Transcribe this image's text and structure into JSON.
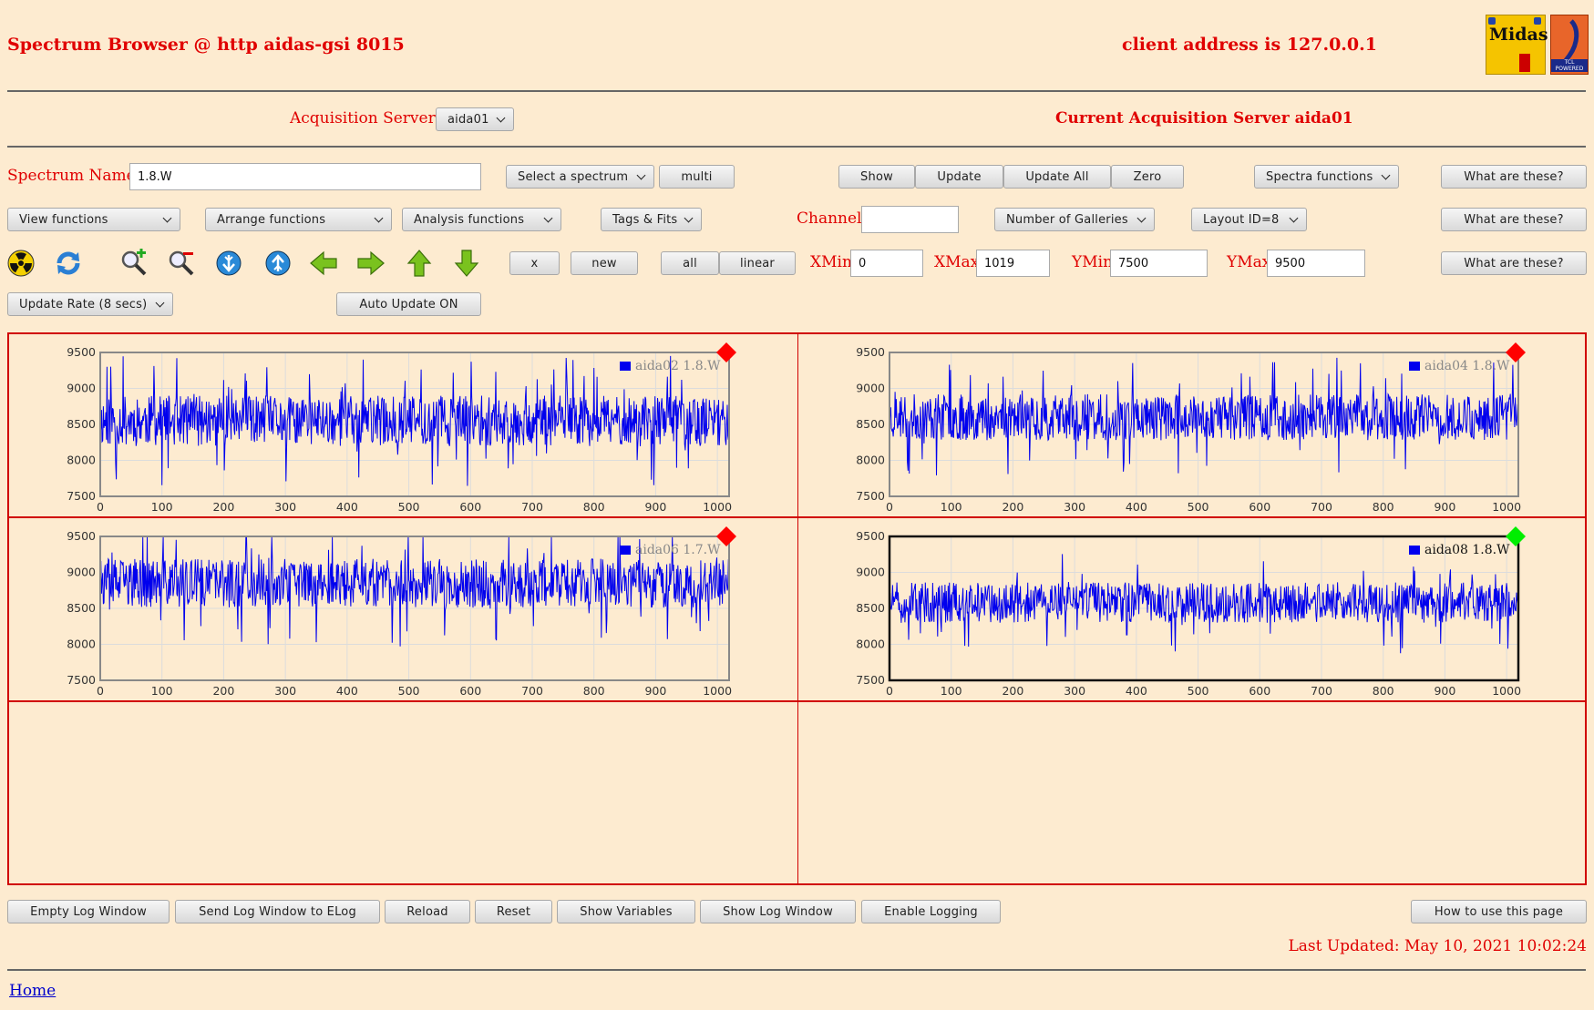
{
  "header": {
    "title": "Spectrum Browser @ http aidas-gsi 8015",
    "client_address": "client address is 127.0.0.1",
    "logo_midas_text": "Midas",
    "logo_tcl_text": "TCL POWERED"
  },
  "servers": {
    "label": "Acquisition Servers",
    "selected": "aida01",
    "current": "Current Acquisition Server aida01"
  },
  "row1": {
    "spectrum_name_label": "Spectrum Name:",
    "spectrum_name_value": "1.8.W",
    "select_spectrum": "Select a spectrum",
    "multi": "multi",
    "show": "Show",
    "update": "Update",
    "update_all": "Update All",
    "zero": "Zero",
    "spectra_functions": "Spectra functions",
    "what1": "What are these?"
  },
  "row2": {
    "view_functions": "View functions",
    "arrange_functions": "Arrange functions",
    "analysis_functions": "Analysis functions",
    "tags_fits": "Tags & Fits",
    "channel_label": "Channel:",
    "channel_value": "",
    "galleries": "Number of Galleries",
    "layout": "Layout ID=8",
    "what2": "What are these?"
  },
  "row3": {
    "x": "x",
    "new": "new",
    "all": "all",
    "linear": "linear",
    "xmin_label": "XMin",
    "xmin": "0",
    "xmax_label": "XMax",
    "xmax": "1019",
    "ymin_label": "YMin",
    "ymin": "7500",
    "ymax_label": "YMax",
    "ymax": "9500",
    "what3": "What are these?"
  },
  "row4": {
    "update_rate": "Update Rate (8 secs)",
    "auto_update": "Auto Update ON"
  },
  "icons": [
    "radiation-icon",
    "refresh-icon",
    "zoom-in-icon",
    "zoom-out-icon",
    "arrow-down-blue-icon",
    "arrow-up-blue-icon",
    "arrow-left-icon",
    "arrow-right-icon",
    "arrow-up-icon",
    "arrow-down-icon"
  ],
  "colors": {
    "background": "#fdebd0",
    "accent": "#e00000",
    "series": "#0000ee",
    "marker_inactive": "#ff0000",
    "marker_active": "#00ee00"
  },
  "chart_data": [
    {
      "type": "line",
      "series": [
        {
          "name": "aida02 1.8.W",
          "seed": 11,
          "base": 8550,
          "amp": 350
        }
      ],
      "xlim": [
        0,
        1019
      ],
      "ylim": [
        7500,
        9500
      ],
      "x_ticks": [
        "0",
        "100",
        "200",
        "300",
        "400",
        "500",
        "600",
        "700",
        "800",
        "900",
        "1000"
      ],
      "y_ticks": [
        "9500",
        "9000",
        "8500",
        "8000",
        "7500"
      ],
      "legend": "top-right",
      "grid": true,
      "active": false
    },
    {
      "type": "line",
      "series": [
        {
          "name": "aida04 1.8.W",
          "seed": 23,
          "base": 8600,
          "amp": 320
        }
      ],
      "xlim": [
        0,
        1019
      ],
      "ylim": [
        7500,
        9500
      ],
      "x_ticks": [
        "0",
        "100",
        "200",
        "300",
        "400",
        "500",
        "600",
        "700",
        "800",
        "900",
        "1000"
      ],
      "y_ticks": [
        "9500",
        "9000",
        "8500",
        "8000",
        "7500"
      ],
      "legend": "top-right",
      "grid": true,
      "active": false
    },
    {
      "type": "line",
      "series": [
        {
          "name": "aida06 1.7.W",
          "seed": 37,
          "base": 8850,
          "amp": 340
        }
      ],
      "xlim": [
        0,
        1019
      ],
      "ylim": [
        7500,
        9500
      ],
      "x_ticks": [
        "0",
        "100",
        "200",
        "300",
        "400",
        "500",
        "600",
        "700",
        "800",
        "900",
        "1000"
      ],
      "y_ticks": [
        "9500",
        "9000",
        "8500",
        "8000",
        "7500"
      ],
      "legend": "top-right",
      "grid": true,
      "active": false
    },
    {
      "type": "line",
      "series": [
        {
          "name": "aida08 1.8.W",
          "seed": 51,
          "base": 8580,
          "amp": 280
        }
      ],
      "xlim": [
        0,
        1019
      ],
      "ylim": [
        7500,
        9500
      ],
      "x_ticks": [
        "0",
        "100",
        "200",
        "300",
        "400",
        "500",
        "600",
        "700",
        "800",
        "900",
        "1000"
      ],
      "y_ticks": [
        "9500",
        "9000",
        "8500",
        "8000",
        "7500"
      ],
      "legend": "top-right",
      "grid": true,
      "active": true
    }
  ],
  "bottom": {
    "empty_log": "Empty Log Window",
    "send_log": "Send Log Window to ELog",
    "reload": "Reload",
    "reset": "Reset",
    "show_vars": "Show Variables",
    "show_log": "Show Log Window",
    "enable_logging": "Enable Logging",
    "how_to": "How to use this page",
    "last_updated": "Last Updated: May 10, 2021 10:02:24",
    "home": "Home"
  }
}
